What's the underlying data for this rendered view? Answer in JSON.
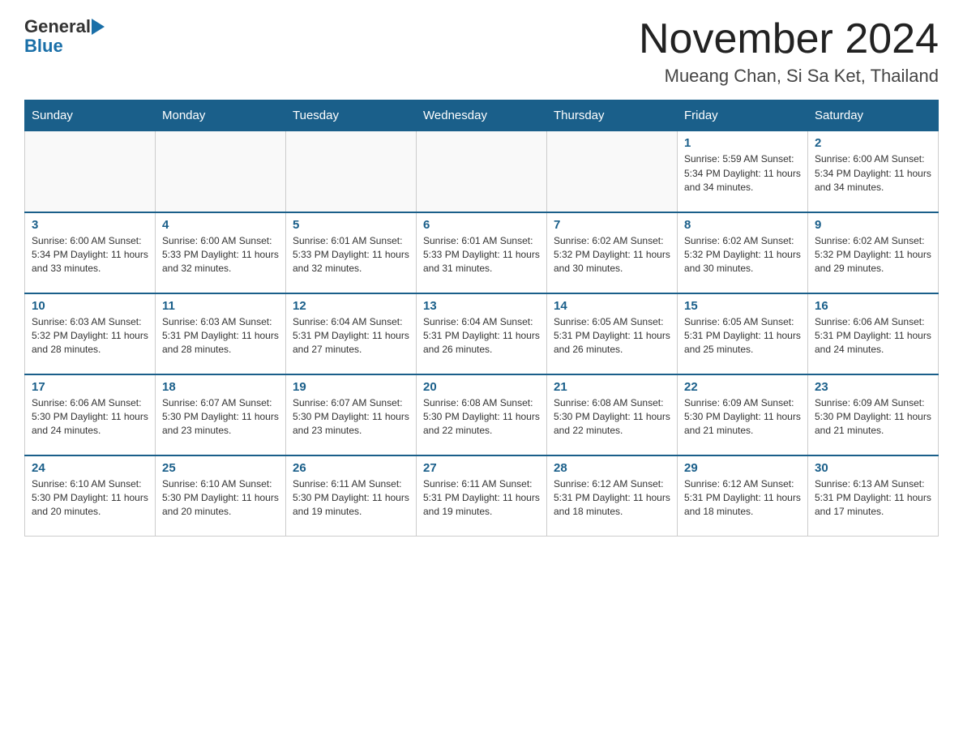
{
  "header": {
    "logo": {
      "general_text": "General",
      "blue_text": "Blue"
    },
    "title": "November 2024",
    "location": "Mueang Chan, Si Sa Ket, Thailand"
  },
  "calendar": {
    "days_of_week": [
      "Sunday",
      "Monday",
      "Tuesday",
      "Wednesday",
      "Thursday",
      "Friday",
      "Saturday"
    ],
    "weeks": [
      [
        {
          "day": "",
          "info": ""
        },
        {
          "day": "",
          "info": ""
        },
        {
          "day": "",
          "info": ""
        },
        {
          "day": "",
          "info": ""
        },
        {
          "day": "",
          "info": ""
        },
        {
          "day": "1",
          "info": "Sunrise: 5:59 AM\nSunset: 5:34 PM\nDaylight: 11 hours and 34 minutes."
        },
        {
          "day": "2",
          "info": "Sunrise: 6:00 AM\nSunset: 5:34 PM\nDaylight: 11 hours and 34 minutes."
        }
      ],
      [
        {
          "day": "3",
          "info": "Sunrise: 6:00 AM\nSunset: 5:34 PM\nDaylight: 11 hours and 33 minutes."
        },
        {
          "day": "4",
          "info": "Sunrise: 6:00 AM\nSunset: 5:33 PM\nDaylight: 11 hours and 32 minutes."
        },
        {
          "day": "5",
          "info": "Sunrise: 6:01 AM\nSunset: 5:33 PM\nDaylight: 11 hours and 32 minutes."
        },
        {
          "day": "6",
          "info": "Sunrise: 6:01 AM\nSunset: 5:33 PM\nDaylight: 11 hours and 31 minutes."
        },
        {
          "day": "7",
          "info": "Sunrise: 6:02 AM\nSunset: 5:32 PM\nDaylight: 11 hours and 30 minutes."
        },
        {
          "day": "8",
          "info": "Sunrise: 6:02 AM\nSunset: 5:32 PM\nDaylight: 11 hours and 30 minutes."
        },
        {
          "day": "9",
          "info": "Sunrise: 6:02 AM\nSunset: 5:32 PM\nDaylight: 11 hours and 29 minutes."
        }
      ],
      [
        {
          "day": "10",
          "info": "Sunrise: 6:03 AM\nSunset: 5:32 PM\nDaylight: 11 hours and 28 minutes."
        },
        {
          "day": "11",
          "info": "Sunrise: 6:03 AM\nSunset: 5:31 PM\nDaylight: 11 hours and 28 minutes."
        },
        {
          "day": "12",
          "info": "Sunrise: 6:04 AM\nSunset: 5:31 PM\nDaylight: 11 hours and 27 minutes."
        },
        {
          "day": "13",
          "info": "Sunrise: 6:04 AM\nSunset: 5:31 PM\nDaylight: 11 hours and 26 minutes."
        },
        {
          "day": "14",
          "info": "Sunrise: 6:05 AM\nSunset: 5:31 PM\nDaylight: 11 hours and 26 minutes."
        },
        {
          "day": "15",
          "info": "Sunrise: 6:05 AM\nSunset: 5:31 PM\nDaylight: 11 hours and 25 minutes."
        },
        {
          "day": "16",
          "info": "Sunrise: 6:06 AM\nSunset: 5:31 PM\nDaylight: 11 hours and 24 minutes."
        }
      ],
      [
        {
          "day": "17",
          "info": "Sunrise: 6:06 AM\nSunset: 5:30 PM\nDaylight: 11 hours and 24 minutes."
        },
        {
          "day": "18",
          "info": "Sunrise: 6:07 AM\nSunset: 5:30 PM\nDaylight: 11 hours and 23 minutes."
        },
        {
          "day": "19",
          "info": "Sunrise: 6:07 AM\nSunset: 5:30 PM\nDaylight: 11 hours and 23 minutes."
        },
        {
          "day": "20",
          "info": "Sunrise: 6:08 AM\nSunset: 5:30 PM\nDaylight: 11 hours and 22 minutes."
        },
        {
          "day": "21",
          "info": "Sunrise: 6:08 AM\nSunset: 5:30 PM\nDaylight: 11 hours and 22 minutes."
        },
        {
          "day": "22",
          "info": "Sunrise: 6:09 AM\nSunset: 5:30 PM\nDaylight: 11 hours and 21 minutes."
        },
        {
          "day": "23",
          "info": "Sunrise: 6:09 AM\nSunset: 5:30 PM\nDaylight: 11 hours and 21 minutes."
        }
      ],
      [
        {
          "day": "24",
          "info": "Sunrise: 6:10 AM\nSunset: 5:30 PM\nDaylight: 11 hours and 20 minutes."
        },
        {
          "day": "25",
          "info": "Sunrise: 6:10 AM\nSunset: 5:30 PM\nDaylight: 11 hours and 20 minutes."
        },
        {
          "day": "26",
          "info": "Sunrise: 6:11 AM\nSunset: 5:30 PM\nDaylight: 11 hours and 19 minutes."
        },
        {
          "day": "27",
          "info": "Sunrise: 6:11 AM\nSunset: 5:31 PM\nDaylight: 11 hours and 19 minutes."
        },
        {
          "day": "28",
          "info": "Sunrise: 6:12 AM\nSunset: 5:31 PM\nDaylight: 11 hours and 18 minutes."
        },
        {
          "day": "29",
          "info": "Sunrise: 6:12 AM\nSunset: 5:31 PM\nDaylight: 11 hours and 18 minutes."
        },
        {
          "day": "30",
          "info": "Sunrise: 6:13 AM\nSunset: 5:31 PM\nDaylight: 11 hours and 17 minutes."
        }
      ]
    ]
  }
}
